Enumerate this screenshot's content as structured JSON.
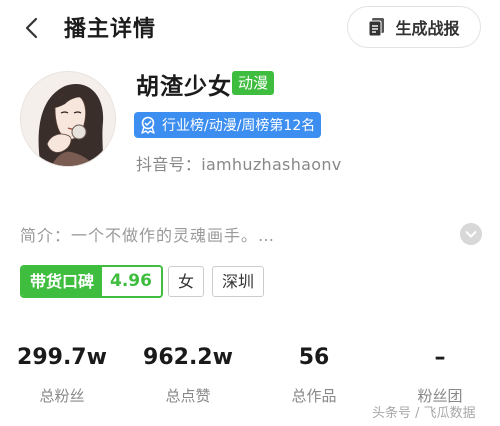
{
  "header": {
    "title": "播主详情",
    "report_button": "生成战报"
  },
  "profile": {
    "name": "胡渣少女",
    "category": "动漫",
    "rank": "行业榜/动漫/周榜第12名",
    "douyin_id": "抖音号：iamhuzhashaonv",
    "bio": "简介：一个不做作的灵魂画手。…"
  },
  "tags": {
    "reputation_label": "带货口碑",
    "reputation_score": "4.96",
    "gender": "女",
    "city": "深圳"
  },
  "stats": [
    {
      "value": "299.7w",
      "label": "总粉丝"
    },
    {
      "value": "962.2w",
      "label": "总点赞"
    },
    {
      "value": "56",
      "label": "总作品"
    },
    {
      "value": "–",
      "label": "粉丝团"
    }
  ],
  "watermark": "头条号 / 飞瓜数据",
  "colors": {
    "accent_green": "#3fbd3f",
    "rank_blue": "#3d8ef1"
  },
  "icons": [
    "back-arrow-icon",
    "document-icon",
    "medal-icon",
    "expand-chevron-icon"
  ]
}
